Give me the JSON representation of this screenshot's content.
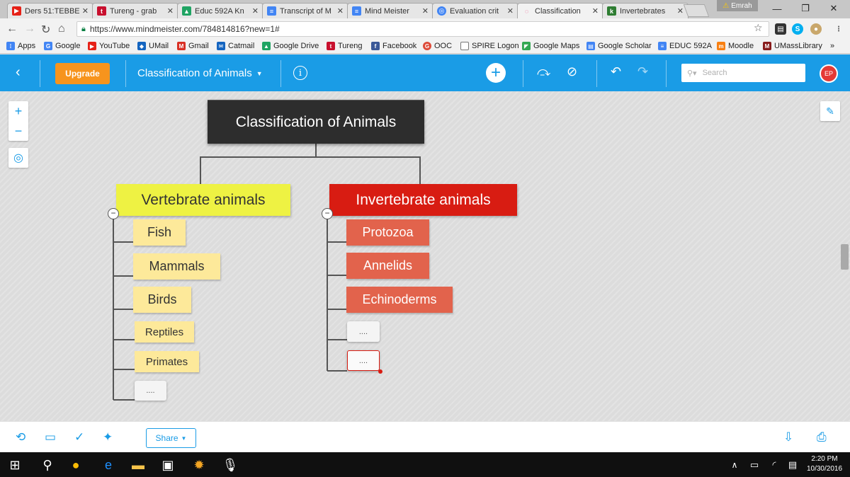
{
  "browser": {
    "tabs": [
      {
        "title": "Ders 51:TEBBE",
        "icon_color": "#e62117",
        "icon": "youtube-icon"
      },
      {
        "title": "Tureng - grab",
        "icon_color": "#c8102e",
        "icon": "tureng-icon"
      },
      {
        "title": "Educ 592A Kn",
        "icon_color": "#1fa463",
        "icon": "drive-icon"
      },
      {
        "title": "Transcript of M",
        "icon_color": "#4285f4",
        "icon": "doc-icon"
      },
      {
        "title": "Mind Meister",
        "icon_color": "#4285f4",
        "icon": "doc-icon"
      },
      {
        "title": "Evaluation crit",
        "icon_color": "#4285f4",
        "icon": "globe-icon"
      },
      {
        "title": "Classification",
        "icon_color": "#e91e63",
        "icon": "mindmeister-icon"
      },
      {
        "title": "Invertebrates",
        "icon_color": "#2e7d32",
        "icon": "site-icon"
      }
    ],
    "profile_name": "Emrah",
    "url": "https://www.mindmeister.com/784814816?new=1#",
    "bookmarks": [
      {
        "label": "Apps",
        "color": "#4285f4"
      },
      {
        "label": "Google",
        "color": "#4285f4"
      },
      {
        "label": "YouTube",
        "color": "#e62117"
      },
      {
        "label": "UMail",
        "color": "#1565c0"
      },
      {
        "label": "Gmail",
        "color": "#d93025"
      },
      {
        "label": "Catmail",
        "color": "#1565c0"
      },
      {
        "label": "Google Drive",
        "color": "#1fa463"
      },
      {
        "label": "Tureng",
        "color": "#c8102e"
      },
      {
        "label": "Facebook",
        "color": "#3b5998"
      },
      {
        "label": "OOC",
        "color": "#dd4b39"
      },
      {
        "label": "SPIRE Logon",
        "color": "#777777"
      },
      {
        "label": "Google Maps",
        "color": "#34a853"
      },
      {
        "label": "Google Scholar",
        "color": "#4285f4"
      },
      {
        "label": "EDUC 592A",
        "color": "#4285f4"
      },
      {
        "label": "Moodle",
        "color": "#f98012"
      },
      {
        "label": "UMassLibrary",
        "color": "#881c1c"
      }
    ],
    "bookmarks_more": "»"
  },
  "toolbar": {
    "upgrade_label": "Upgrade",
    "map_title": "Classification of Animals",
    "search_placeholder": "Search",
    "avatar_initials": "EP"
  },
  "mindmap": {
    "root": "Classification of Animals",
    "vertebrate": {
      "label": "Vertebrate animals",
      "color": "#eef243",
      "children": [
        "Fish",
        "Mammals",
        "Birds",
        "Reptiles",
        "Primates",
        "...."
      ]
    },
    "invertebrate": {
      "label": "Invertebrate animals",
      "color": "#d81c12",
      "children": [
        "Protozoa",
        "Annelids",
        "Echinoderms",
        "....",
        "...."
      ]
    }
  },
  "bottom": {
    "share_label": "Share"
  },
  "taskbar": {
    "time": "2:20 PM",
    "date": "10/30/2016"
  }
}
